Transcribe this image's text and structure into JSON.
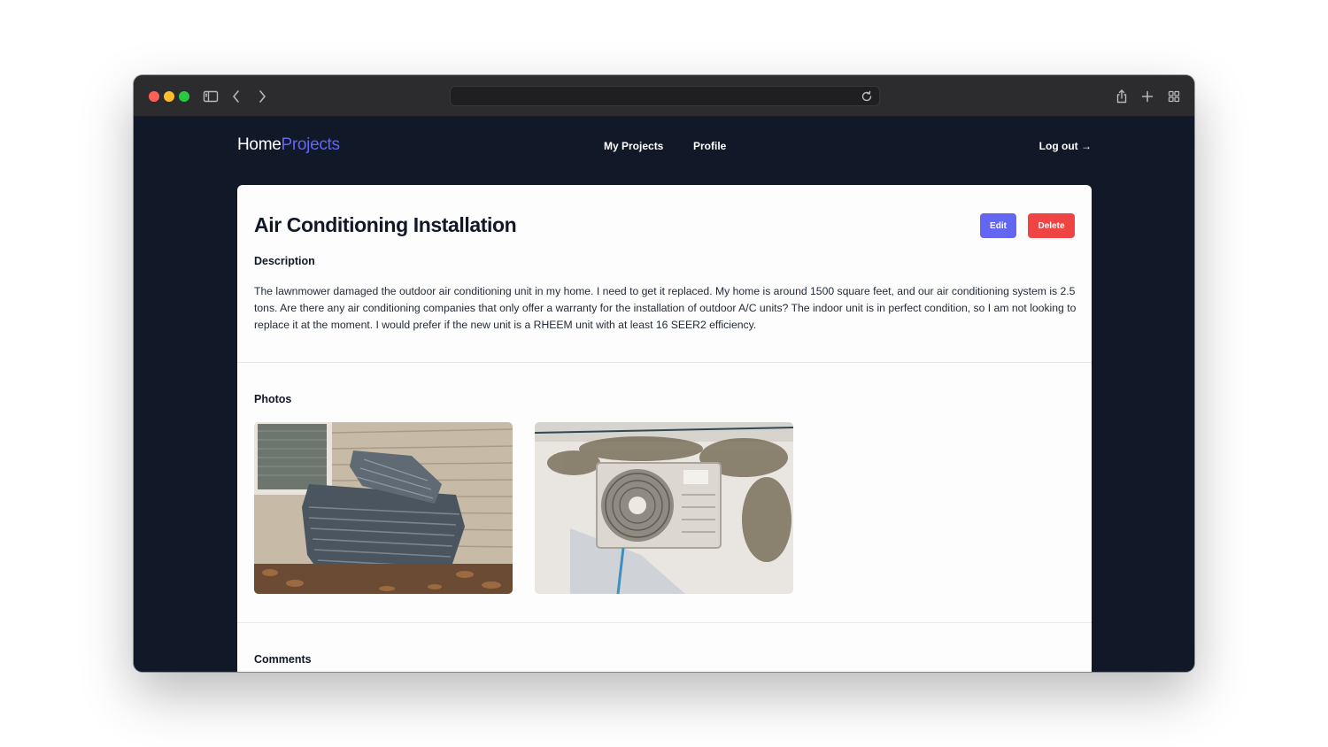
{
  "browser": {
    "url": "",
    "icons": [
      "sidebar-toggle-icon",
      "back-icon",
      "forward-icon",
      "reload-icon",
      "share-icon",
      "new-tab-icon",
      "tab-overview-icon"
    ]
  },
  "header": {
    "brand_home": "Home",
    "brand_projects": "Projects",
    "nav": {
      "my_projects": "My Projects",
      "profile": "Profile"
    },
    "logout": "Log out →"
  },
  "project": {
    "title": "Air Conditioning Installation",
    "edit_label": "Edit",
    "delete_label": "Delete",
    "description_heading": "Description",
    "description": "The lawnmower damaged the outdoor air conditioning unit in my home. I need to get it replaced. My home is around 1500 square feet, and our air conditioning system is 2.5 tons. Are there any air conditioning companies that only offer a warranty for the installation of outdoor A/C units? The indoor unit is in perfect condition, so I am not looking to replace it at the moment. I would prefer if the new unit is a RHEEM unit with at least 16 SEER2 efficiency.",
    "photos_heading": "Photos",
    "comments_heading": "Comments"
  },
  "colors": {
    "page_bg": "#111827",
    "accent": "#6366f1",
    "danger": "#ef4444",
    "card_bg": "#fdfdfd"
  }
}
